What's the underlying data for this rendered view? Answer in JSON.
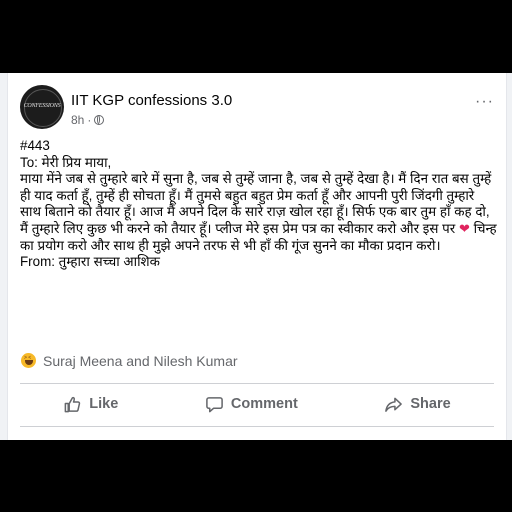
{
  "post": {
    "page_name": "IIT KGP confessions 3.0",
    "time": "8h",
    "dot": "·",
    "more": "···",
    "avatar_text": "CONFESSIONS",
    "lines": [
      "#443",
      "To: मेरी प्रिय माया,"
    ],
    "body_before_heart": "माया मेंने जब से तुम्हारे बारे में सुना है, जब से तुम्हें जाना है, जब से तुम्हें देखा है। मैं दिन रात बस तुम्हें ही याद कर्ता हूँ, तुम्हें ही सोचता हूँ। मैं तुमसे बहुत बहुत प्रेम कर्ता हूँ और आपनी पुरी जिंदगी तुम्हारे साथ बिताने को तैयार हूँ। आज मैं  अपने दिल के सारे राज़ खोल रहा हूँ। सिर्फ एक बार तुम हाँ कह दो, मैं तुम्हारे लिए कुछ भी करने को तैयार हूँ। प्लीज मेरे इस प्रेम पत्र का स्वीकार करो और इस पर",
    "heart": "❤",
    "body_after_heart": " चिन्ह का प्रयोग करो और साथ ही मुझे अपने तरफ से भी हाँ की गूंज सुनने का मौका प्रदान करो।",
    "signoff": "From: तुम्हारा सच्चा आशिक"
  },
  "reactions": {
    "icon": "haha-reaction-icon",
    "names": "Suraj Meena and Nilesh Kumar"
  },
  "actions": {
    "like": "Like",
    "comment": "Comment",
    "share": "Share"
  },
  "colors": {
    "text": "#050505",
    "secondary": "#65676b",
    "haha": "#f7b928",
    "heart": "#e0245e"
  }
}
